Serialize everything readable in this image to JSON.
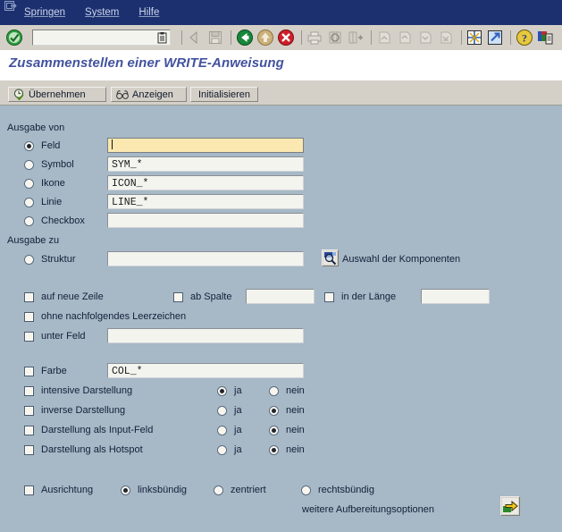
{
  "window": {
    "menu": [
      "Springen",
      "System",
      "Hilfe"
    ],
    "window_icon": "window-exit-icon"
  },
  "toolbar": {
    "ok_icon": "green-check-icon",
    "command_field_value": "",
    "command_field_icon": "clipboard-dropdown-icon",
    "buttons": [
      {
        "name": "back-arrow-icon",
        "enabled": false
      },
      {
        "name": "save-icon",
        "enabled": false
      },
      {
        "name": "green-back-icon",
        "enabled": true
      },
      {
        "name": "exit-up-icon",
        "enabled": true
      },
      {
        "name": "cancel-red-x-icon",
        "enabled": true
      },
      {
        "name": "print-icon",
        "enabled": false
      },
      {
        "name": "find-icon",
        "enabled": true
      },
      {
        "name": "find-next-icon",
        "enabled": true
      },
      {
        "name": "first-page-icon",
        "enabled": false
      },
      {
        "name": "previous-page-icon",
        "enabled": false
      },
      {
        "name": "next-page-icon",
        "enabled": false
      },
      {
        "name": "last-page-icon",
        "enabled": false
      },
      {
        "name": "new-window-icon",
        "enabled": true
      },
      {
        "name": "create-shortcut-icon",
        "enabled": true
      },
      {
        "name": "help-icon",
        "enabled": true
      },
      {
        "name": "customize-local-layout-icon",
        "enabled": true
      }
    ]
  },
  "page": {
    "title": "Zusammenstellen einer WRITE-Anweisung",
    "title_color": "#42529e"
  },
  "app_toolbar": {
    "buttons": [
      {
        "label": "Übernehmen",
        "icon": "clock-check-icon"
      },
      {
        "label": "Anzeigen",
        "icon": "glasses-icon"
      },
      {
        "label": "Initialisieren",
        "icon": ""
      }
    ]
  },
  "form": {
    "section_output_from": {
      "label": "Ausgabe von",
      "rows": [
        {
          "label": "Feld",
          "selected": true,
          "value": "",
          "focused": true
        },
        {
          "label": "Symbol",
          "selected": false,
          "value": "SYM_*",
          "focused": false
        },
        {
          "label": "Ikone",
          "selected": false,
          "value": "ICON_*",
          "focused": false
        },
        {
          "label": "Linie",
          "selected": false,
          "value": "LINE_*",
          "focused": false
        },
        {
          "label": "Checkbox",
          "selected": false,
          "value": "",
          "focused": false
        }
      ]
    },
    "section_output_to": {
      "label": "Ausgabe zu",
      "struktur": {
        "label": "Struktur",
        "selected": false,
        "value": ""
      },
      "component_select": {
        "label": "Auswahl der Komponenten",
        "icon": "search-magnifier-icon"
      }
    },
    "position_options": {
      "new_line": {
        "label": "auf neue Zeile",
        "checked": false
      },
      "from_column": {
        "label": "ab Spalte",
        "checked": false,
        "value": ""
      },
      "length": {
        "label": "in der Länge",
        "checked": false,
        "value": ""
      },
      "no_trailing_blank": {
        "label": "ohne nachfolgendes Leerzeichen",
        "checked": false
      },
      "under_field": {
        "label": "unter Feld",
        "checked": false,
        "value": ""
      }
    },
    "display_options": {
      "color": {
        "label": "Farbe",
        "checked": false,
        "value": "COL_*"
      },
      "yes_label": "ja",
      "no_label": "nein",
      "rows": [
        {
          "label": "intensive Darstellung",
          "checked": false,
          "choice": "ja"
        },
        {
          "label": "inverse Darstellung",
          "checked": false,
          "choice": "nein"
        },
        {
          "label": "Darstellung als Input-Feld",
          "checked": false,
          "choice": "nein"
        },
        {
          "label": "Darstellung als Hotspot",
          "checked": false,
          "choice": "nein"
        }
      ]
    },
    "alignment": {
      "label": "Ausrichtung",
      "checked": false,
      "options": [
        {
          "label": "linksbündig",
          "selected": true
        },
        {
          "label": "zentriert",
          "selected": false
        },
        {
          "label": "rechtsbündig",
          "selected": false
        }
      ]
    },
    "more_options": {
      "label": "weitere Aufbereitungsoptionen",
      "icon": "yellow-arrow-execute-icon"
    }
  }
}
